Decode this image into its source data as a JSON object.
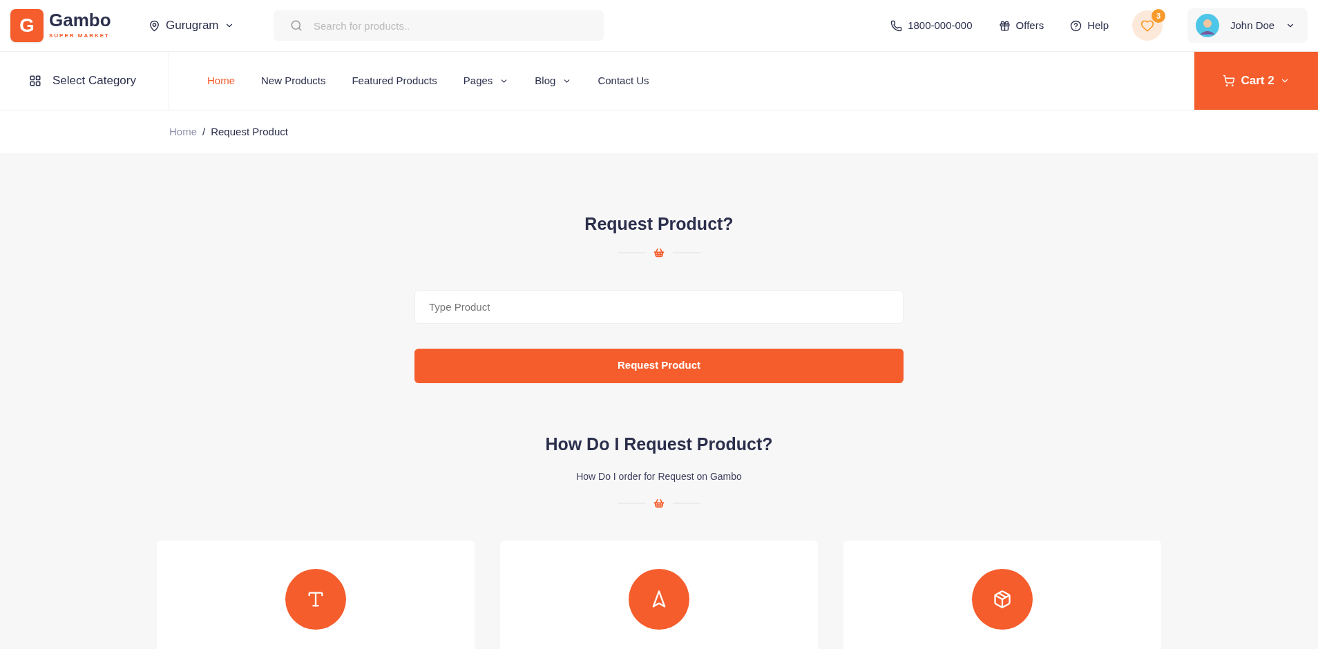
{
  "logo": {
    "letter": "G",
    "name": "Gambo",
    "tagline": "SUPER MARKET"
  },
  "location": {
    "label": "Gurugram"
  },
  "search": {
    "placeholder": "Search for products.."
  },
  "top_links": [
    {
      "kind": "phone",
      "label": "1800-000-000"
    },
    {
      "kind": "offers",
      "label": "Offers"
    },
    {
      "kind": "help",
      "label": "Help"
    }
  ],
  "wishlist": {
    "count": "3"
  },
  "user": {
    "name": "John Doe"
  },
  "category_button": {
    "label": "Select Category"
  },
  "nav": [
    {
      "label": "Home",
      "selected": true,
      "dropdown": false
    },
    {
      "label": "New Products",
      "selected": false,
      "dropdown": false
    },
    {
      "label": "Featured Products",
      "selected": false,
      "dropdown": false
    },
    {
      "label": "Pages",
      "selected": false,
      "dropdown": true
    },
    {
      "label": "Blog",
      "selected": false,
      "dropdown": true
    },
    {
      "label": "Contact Us",
      "selected": false,
      "dropdown": false
    }
  ],
  "cart": {
    "label": "Cart 2"
  },
  "breadcrumb": {
    "separator": "/",
    "items": [
      "Home",
      "Request Product"
    ]
  },
  "request": {
    "title": "Request Product?",
    "placeholder": "Type Product",
    "button": "Request Product"
  },
  "how": {
    "title": "How Do I Request Product?",
    "subtitle": "How Do I order for Request on Gambo"
  },
  "steps": [
    {
      "kind": "text"
    },
    {
      "kind": "send"
    },
    {
      "kind": "package"
    }
  ]
}
